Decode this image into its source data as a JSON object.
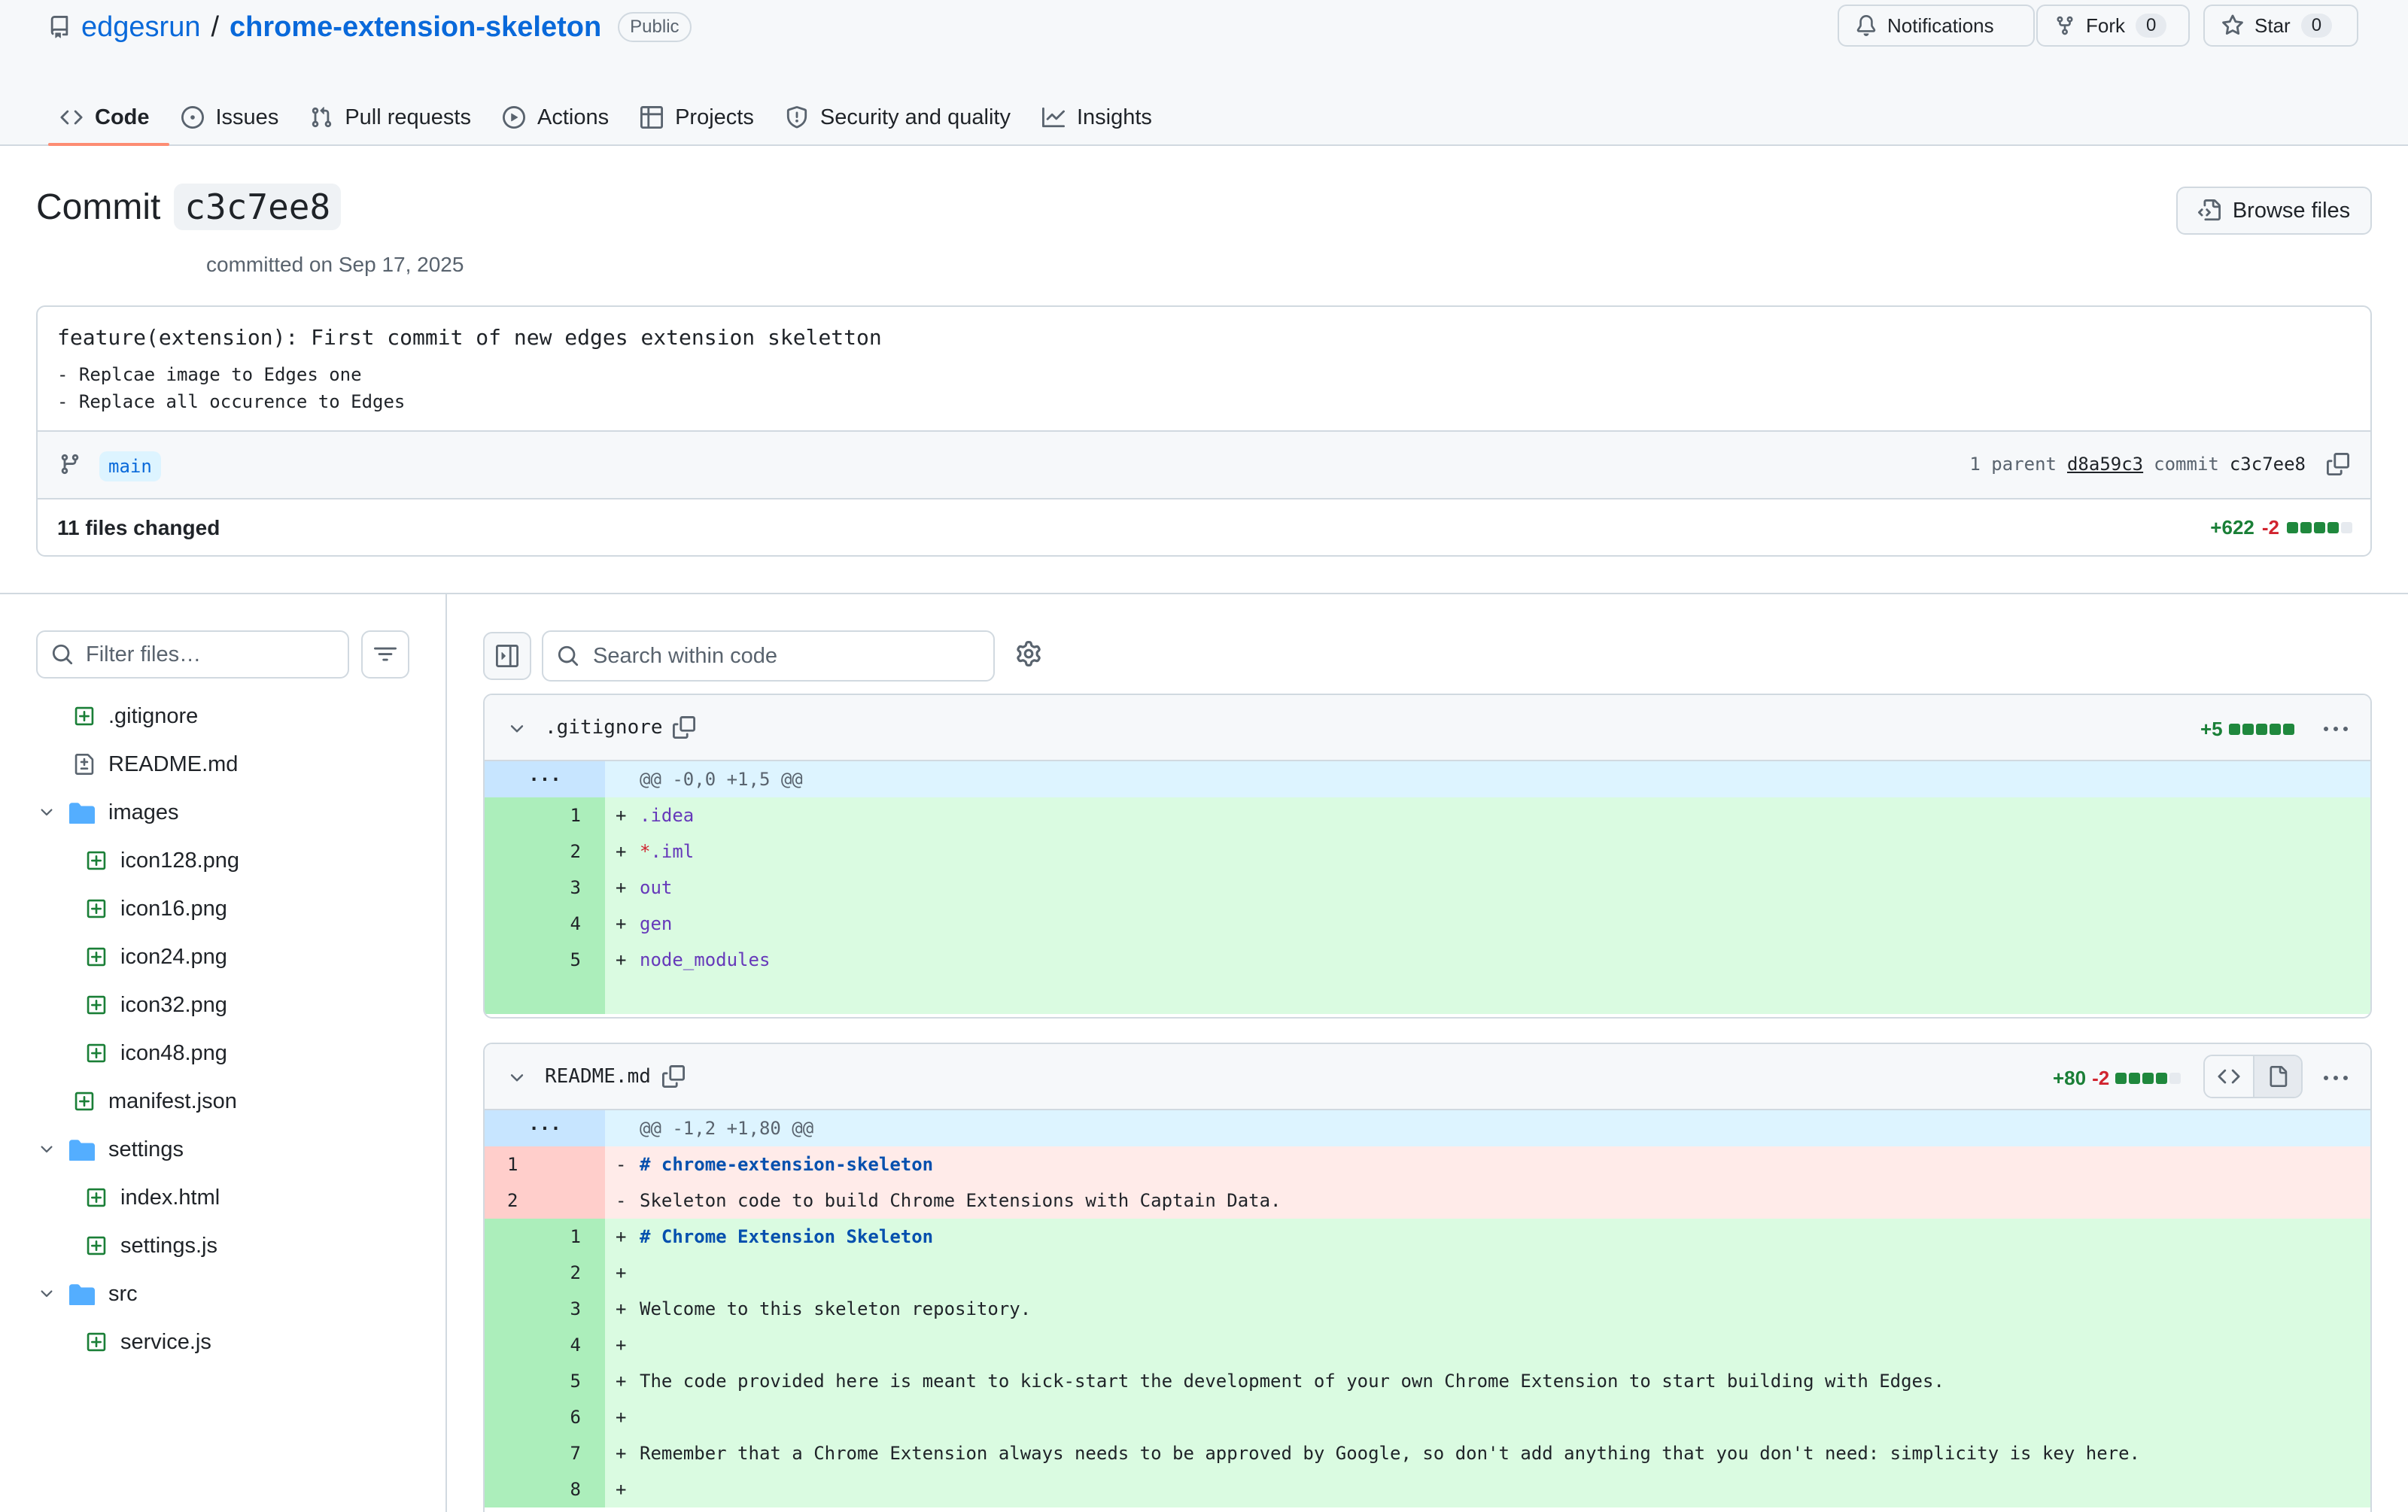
{
  "repo": {
    "owner": "edgesrun",
    "slash": "/",
    "name": "chrome-extension-skeleton",
    "visibility": "Public",
    "notifications_label": "Notifications",
    "fork_label": "Fork",
    "fork_count": "0",
    "star_label": "Star",
    "star_count": "0"
  },
  "tabs": [
    {
      "label": "Code",
      "icon": "code-icon",
      "active": true
    },
    {
      "label": "Issues",
      "icon": "issue-icon"
    },
    {
      "label": "Pull requests",
      "icon": "pull-request-icon"
    },
    {
      "label": "Actions",
      "icon": "play-icon"
    },
    {
      "label": "Projects",
      "icon": "table-icon"
    },
    {
      "label": "Security and quality",
      "icon": "shield-icon"
    },
    {
      "label": "Insights",
      "icon": "graph-icon"
    }
  ],
  "commit": {
    "heading": "Commit",
    "sha_short": "c3c7ee8",
    "browse_files_label": "Browse files",
    "committed_text": "committed on Sep 17, 2025",
    "message_title": "feature(extension): First commit of new edges extension skeletton",
    "message_lines": [
      "- Replcae image to Edges one",
      "- Replace all occurence to Edges"
    ],
    "branch": "main",
    "parent_label": "1 parent",
    "parent_sha": "d8a59c3",
    "commit_label": "commit",
    "commit_sha": "c3c7ee8",
    "files_changed": "11 files changed",
    "additions": "+622",
    "deletions": "-2",
    "colors": {
      "add": "#1a7f37",
      "del": "#d1242f",
      "active_tab_underline": "#fd8c73",
      "link": "#0969da"
    }
  },
  "sidebar": {
    "filter_placeholder": "Filter files…",
    "tree": [
      {
        "label": ".gitignore",
        "type": "file-added",
        "depth": 1
      },
      {
        "label": "README.md",
        "type": "file-modified",
        "depth": 1
      },
      {
        "label": "images",
        "type": "folder",
        "depth": 0
      },
      {
        "label": "icon128.png",
        "type": "file-added",
        "depth": 2
      },
      {
        "label": "icon16.png",
        "type": "file-added",
        "depth": 2
      },
      {
        "label": "icon24.png",
        "type": "file-added",
        "depth": 2
      },
      {
        "label": "icon32.png",
        "type": "file-added",
        "depth": 2
      },
      {
        "label": "icon48.png",
        "type": "file-added",
        "depth": 2
      },
      {
        "label": "manifest.json",
        "type": "file-added",
        "depth": 1
      },
      {
        "label": "settings",
        "type": "folder",
        "depth": 0
      },
      {
        "label": "index.html",
        "type": "file-added",
        "depth": 2
      },
      {
        "label": "settings.js",
        "type": "file-added",
        "depth": 2
      },
      {
        "label": "src",
        "type": "folder",
        "depth": 0
      },
      {
        "label": "service.js",
        "type": "file-added",
        "depth": 2
      }
    ]
  },
  "diff": {
    "search_placeholder": "Search within code",
    "files": [
      {
        "name": ".gitignore",
        "additions": "+5",
        "hunk": "@@ -0,0 +1,5 @@",
        "lines": [
          {
            "type": "ins",
            "new": "1",
            "sign": "+",
            "text": ".idea"
          },
          {
            "type": "ins",
            "new": "2",
            "sign": "+",
            "text": "*.iml"
          },
          {
            "type": "ins",
            "new": "3",
            "sign": "+",
            "text": "out"
          },
          {
            "type": "ins",
            "new": "4",
            "sign": "+",
            "text": "gen"
          },
          {
            "type": "ins",
            "new": "5",
            "sign": "+",
            "text": "node_modules"
          }
        ]
      },
      {
        "name": "README.md",
        "additions": "+80",
        "deletions": "-2",
        "hunk": "@@ -1,2 +1,80 @@",
        "lines": [
          {
            "type": "rem",
            "old": "1",
            "sign": "-",
            "text": "# chrome-extension-skeleton"
          },
          {
            "type": "rem",
            "old": "2",
            "sign": "-",
            "text": "Skeleton code to build Chrome Extensions with Captain Data."
          },
          {
            "type": "ins",
            "new": "1",
            "sign": "+",
            "text": "# Chrome Extension Skeleton"
          },
          {
            "type": "ins",
            "new": "2",
            "sign": "+",
            "text": ""
          },
          {
            "type": "ins",
            "new": "3",
            "sign": "+",
            "text": "Welcome to this skeleton repository."
          },
          {
            "type": "ins",
            "new": "4",
            "sign": "+",
            "text": ""
          },
          {
            "type": "ins",
            "new": "5",
            "sign": "+",
            "text": "The code provided here is meant to kick-start the development of your own Chrome Extension to start building with Edges."
          },
          {
            "type": "ins",
            "new": "6",
            "sign": "+",
            "text": ""
          },
          {
            "type": "ins",
            "new": "7",
            "sign": "+",
            "text": "Remember that a Chrome Extension always needs to be approved by Google, so don't add anything that you don't need: simplicity is key here."
          },
          {
            "type": "ins",
            "new": "8",
            "sign": "+",
            "text": ""
          }
        ]
      }
    ]
  }
}
